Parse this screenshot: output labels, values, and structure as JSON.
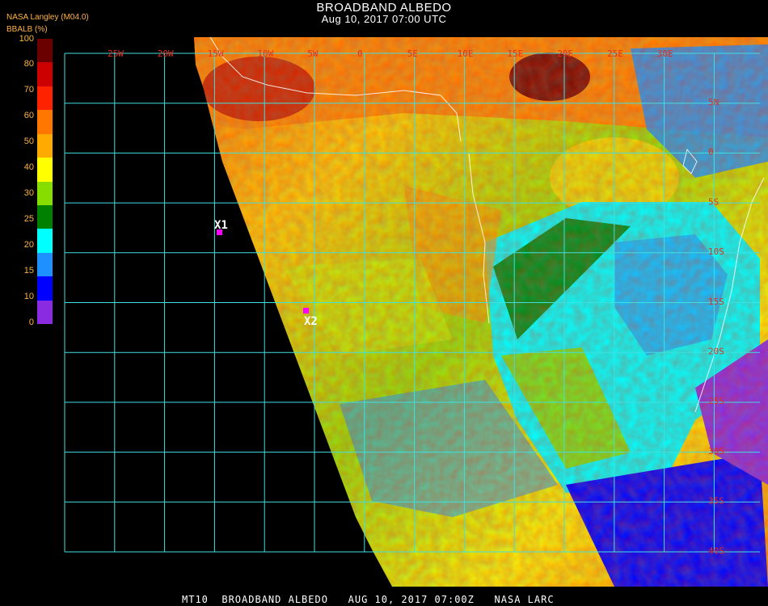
{
  "header": {
    "title": "BROADBAND ALBEDO",
    "subtitle": "Aug 10, 2017 07:00 UTC",
    "org": "NASA Langley (M04.0)"
  },
  "colorbar": {
    "unit": "BBALB (%)",
    "ticks": [
      "100",
      "80",
      "70",
      "60",
      "50",
      "40",
      "30",
      "25",
      "20",
      "15",
      "10",
      "0"
    ],
    "colors": [
      "#6b0000",
      "#cc0000",
      "#ff2200",
      "#ff7700",
      "#ffaa00",
      "#ffff00",
      "#88dd00",
      "#008000",
      "#00ffff",
      "#1e90ff",
      "#0000ff",
      "#8a2be2"
    ]
  },
  "map": {
    "lon_labels": [
      "25W",
      "20W",
      "15W",
      "10W",
      "5W",
      "0",
      "5E",
      "10E",
      "15E",
      "20E",
      "25E",
      "30E"
    ],
    "lat_labels": [
      "5N",
      "0",
      "5S",
      "10S",
      "15S",
      "20S",
      "25S",
      "30S",
      "35S",
      "40S"
    ],
    "markers": [
      {
        "label": "X1",
        "color": "#ff00ff"
      },
      {
        "label": "X2",
        "color": "#ff00ff"
      }
    ],
    "grid_color": "#40e0e0"
  },
  "footer": {
    "text": "MT10  BROADBAND ALBEDO   AUG 10, 2017 07:00Z   NASA LARC"
  }
}
